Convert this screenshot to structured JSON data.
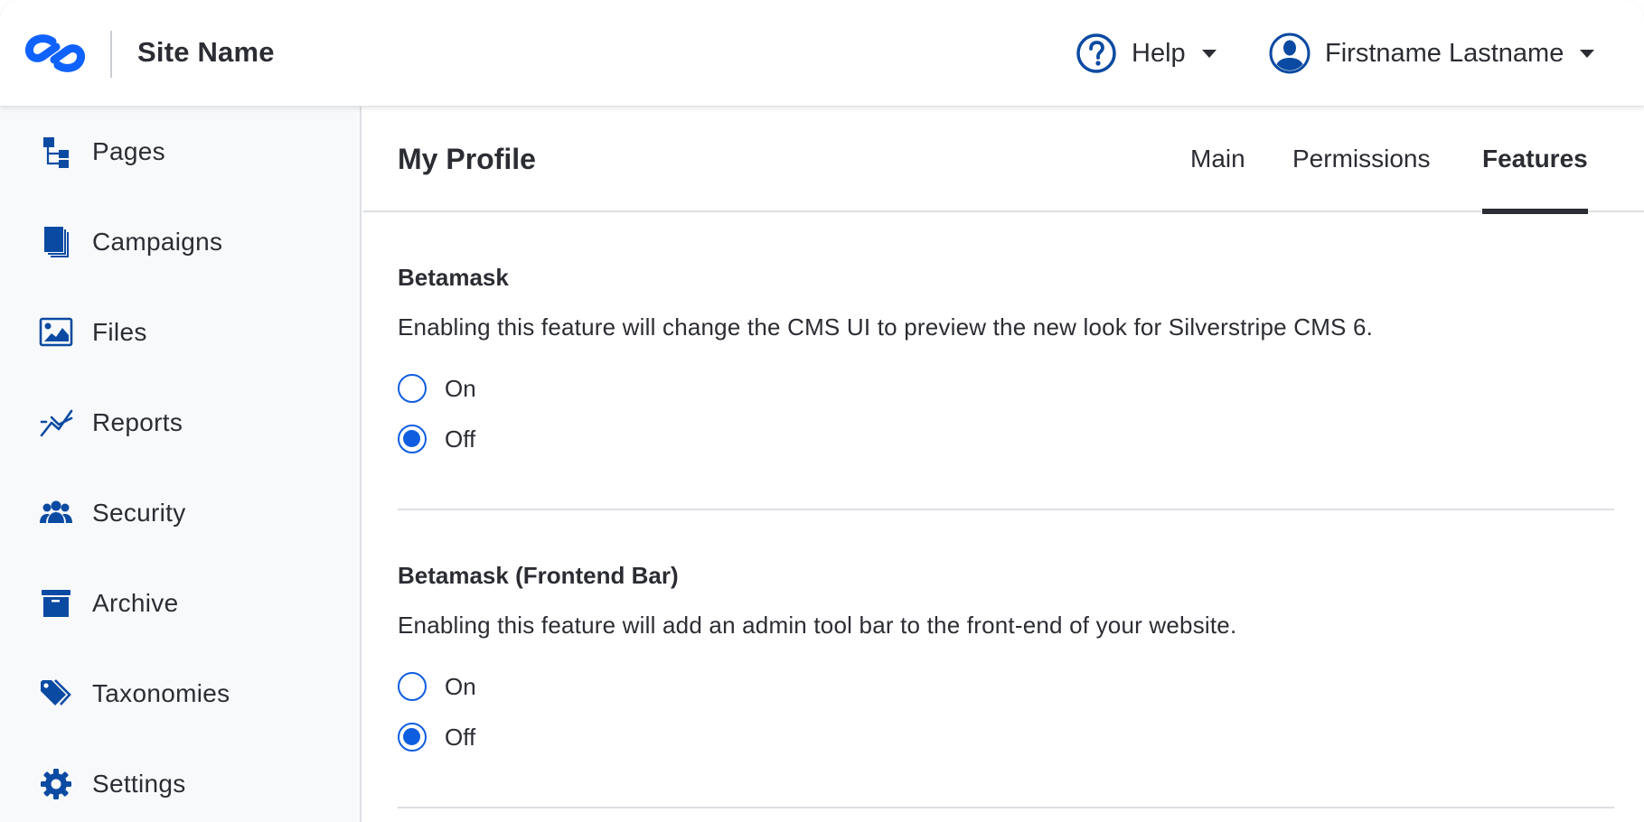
{
  "header": {
    "site_name": "Site Name",
    "logo_icon": "silverstripe-logo-icon",
    "help": {
      "label": "Help",
      "icon": "question-circle-icon"
    },
    "user": {
      "label": "Firstname Lastname",
      "icon": "user-avatar-icon"
    }
  },
  "sidebar": {
    "items": [
      {
        "label": "Pages",
        "icon": "sitetree-icon"
      },
      {
        "label": "Campaigns",
        "icon": "documents-stack-icon"
      },
      {
        "label": "Files",
        "icon": "image-icon"
      },
      {
        "label": "Reports",
        "icon": "line-chart-icon"
      },
      {
        "label": "Security",
        "icon": "users-group-icon"
      },
      {
        "label": "Archive",
        "icon": "archive-box-icon"
      },
      {
        "label": "Taxonomies",
        "icon": "tags-icon"
      },
      {
        "label": "Settings",
        "icon": "gear-icon"
      }
    ]
  },
  "main": {
    "title": "My Profile",
    "tabs": [
      {
        "label": "Main",
        "active": false
      },
      {
        "label": "Permissions",
        "active": false
      },
      {
        "label": "Features",
        "active": true
      }
    ],
    "features": [
      {
        "title": "Betamask",
        "description": "Enabling this feature will change the CMS UI to preview the new look for Silverstripe CMS 6.",
        "options": [
          {
            "label": "On",
            "checked": false
          },
          {
            "label": "Off",
            "checked": true
          }
        ]
      },
      {
        "title": "Betamask (Frontend Bar)",
        "description": "Enabling this feature will add an admin tool bar to the front-end of your website.",
        "options": [
          {
            "label": "On",
            "checked": false
          },
          {
            "label": "Off",
            "checked": true
          }
        ]
      }
    ]
  },
  "colors": {
    "accent": "#0f5ee0",
    "icon": "#0b4aa2",
    "text": "#2b2d33",
    "sidebar_bg": "#f7f9fb",
    "border": "#dcdfe3"
  }
}
